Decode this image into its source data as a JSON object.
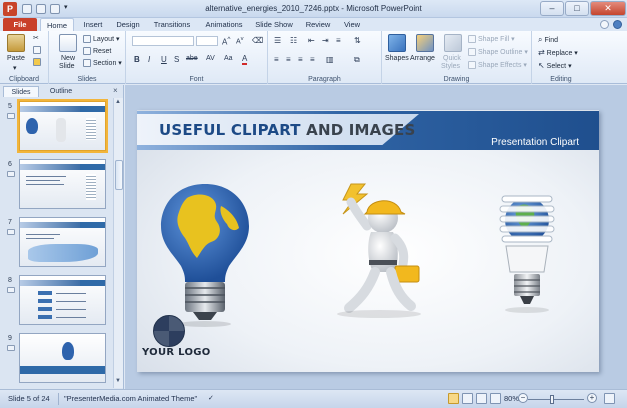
{
  "window": {
    "title": "alternative_energies_2010_7246.pptx - Microsoft PowerPoint",
    "app_icon": "P"
  },
  "ribbon_tabs": [
    "File",
    "Home",
    "Insert",
    "Design",
    "Transitions",
    "Animations",
    "Slide Show",
    "Review",
    "View"
  ],
  "ribbon": {
    "clipboard": {
      "paste": "Paste",
      "label": "Clipboard"
    },
    "slides": {
      "new_slide": "New",
      "new_slide_2": "Slide",
      "layout": "Layout",
      "reset": "Reset",
      "section": "Section",
      "label": "Slides"
    },
    "font": {
      "label": "Font",
      "grow": "A",
      "shrink": "A",
      "bold": "B",
      "italic": "I",
      "underline": "U",
      "strike": "S",
      "shadow": "abe",
      "spacing": "AV",
      "case": "Aa",
      "color": "A"
    },
    "paragraph": {
      "label": "Paragraph"
    },
    "drawing": {
      "shapes": "Shapes",
      "arrange": "Arrange",
      "quick_styles_1": "Quick",
      "quick_styles_2": "Styles",
      "shape_fill": "Shape Fill",
      "shape_outline": "Shape Outline",
      "shape_effects": "Shape Effects",
      "label": "Drawing"
    },
    "editing": {
      "find": "Find",
      "replace": "Replace",
      "select": "Select",
      "label": "Editing"
    }
  },
  "left_panel": {
    "tabs": [
      "Slides",
      "Outline"
    ],
    "close": "×",
    "slide_numbers": [
      "5",
      "6",
      "7",
      "8",
      "9"
    ]
  },
  "slide": {
    "title_part1": "USEFUL CLIPART",
    "title_part2": " AND IMAGES",
    "subtitle": "Presentation Clipart",
    "logo_text": "YOUR LOGO"
  },
  "status": {
    "slide_info": "Slide 5 of 24",
    "theme": "\"PresenterMedia.com Animated Theme\"",
    "zoom": "80%"
  },
  "colors": {
    "file_tab": "#c9402a",
    "title_blue": "#1d4a86",
    "band_blue": "#2f63a4",
    "selected_outline": "#f2b53b"
  }
}
